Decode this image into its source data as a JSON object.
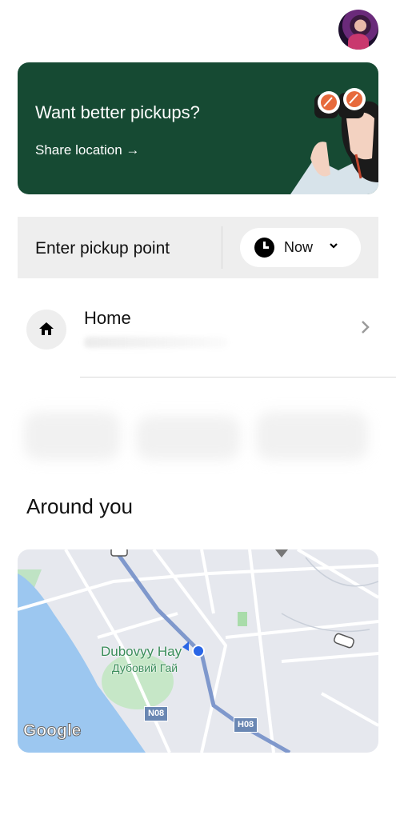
{
  "header": {
    "avatar_alt": "profile-avatar"
  },
  "promo": {
    "title": "Want better pickups?",
    "link": "Share location →",
    "bg_color": "#164a33"
  },
  "pickup": {
    "placeholder": "Enter pickup point",
    "time_label": "Now"
  },
  "saved_places": [
    {
      "label": "Home",
      "icon": "home-icon"
    }
  ],
  "around": {
    "title": "Around you",
    "map": {
      "place_name": "Dubovyy Hay",
      "place_name_local": "Дубовий Гай",
      "road_badges": [
        "N08",
        "H08"
      ],
      "attribution": "Google"
    }
  }
}
